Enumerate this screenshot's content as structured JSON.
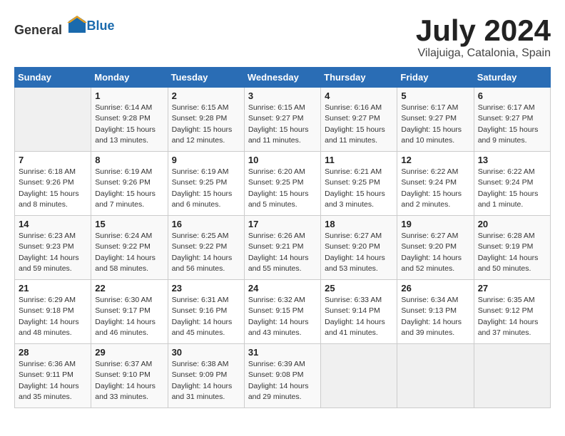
{
  "header": {
    "logo_general": "General",
    "logo_blue": "Blue",
    "title": "July 2024",
    "subtitle": "Vilajuiga, Catalonia, Spain"
  },
  "days_of_week": [
    "Sunday",
    "Monday",
    "Tuesday",
    "Wednesday",
    "Thursday",
    "Friday",
    "Saturday"
  ],
  "weeks": [
    [
      {
        "day": "",
        "info": ""
      },
      {
        "day": "1",
        "info": "Sunrise: 6:14 AM\nSunset: 9:28 PM\nDaylight: 15 hours\nand 13 minutes."
      },
      {
        "day": "2",
        "info": "Sunrise: 6:15 AM\nSunset: 9:28 PM\nDaylight: 15 hours\nand 12 minutes."
      },
      {
        "day": "3",
        "info": "Sunrise: 6:15 AM\nSunset: 9:27 PM\nDaylight: 15 hours\nand 11 minutes."
      },
      {
        "day": "4",
        "info": "Sunrise: 6:16 AM\nSunset: 9:27 PM\nDaylight: 15 hours\nand 11 minutes."
      },
      {
        "day": "5",
        "info": "Sunrise: 6:17 AM\nSunset: 9:27 PM\nDaylight: 15 hours\nand 10 minutes."
      },
      {
        "day": "6",
        "info": "Sunrise: 6:17 AM\nSunset: 9:27 PM\nDaylight: 15 hours\nand 9 minutes."
      }
    ],
    [
      {
        "day": "7",
        "info": "Sunrise: 6:18 AM\nSunset: 9:26 PM\nDaylight: 15 hours\nand 8 minutes."
      },
      {
        "day": "8",
        "info": "Sunrise: 6:19 AM\nSunset: 9:26 PM\nDaylight: 15 hours\nand 7 minutes."
      },
      {
        "day": "9",
        "info": "Sunrise: 6:19 AM\nSunset: 9:25 PM\nDaylight: 15 hours\nand 6 minutes."
      },
      {
        "day": "10",
        "info": "Sunrise: 6:20 AM\nSunset: 9:25 PM\nDaylight: 15 hours\nand 5 minutes."
      },
      {
        "day": "11",
        "info": "Sunrise: 6:21 AM\nSunset: 9:25 PM\nDaylight: 15 hours\nand 3 minutes."
      },
      {
        "day": "12",
        "info": "Sunrise: 6:22 AM\nSunset: 9:24 PM\nDaylight: 15 hours\nand 2 minutes."
      },
      {
        "day": "13",
        "info": "Sunrise: 6:22 AM\nSunset: 9:24 PM\nDaylight: 15 hours\nand 1 minute."
      }
    ],
    [
      {
        "day": "14",
        "info": "Sunrise: 6:23 AM\nSunset: 9:23 PM\nDaylight: 14 hours\nand 59 minutes."
      },
      {
        "day": "15",
        "info": "Sunrise: 6:24 AM\nSunset: 9:22 PM\nDaylight: 14 hours\nand 58 minutes."
      },
      {
        "day": "16",
        "info": "Sunrise: 6:25 AM\nSunset: 9:22 PM\nDaylight: 14 hours\nand 56 minutes."
      },
      {
        "day": "17",
        "info": "Sunrise: 6:26 AM\nSunset: 9:21 PM\nDaylight: 14 hours\nand 55 minutes."
      },
      {
        "day": "18",
        "info": "Sunrise: 6:27 AM\nSunset: 9:20 PM\nDaylight: 14 hours\nand 53 minutes."
      },
      {
        "day": "19",
        "info": "Sunrise: 6:27 AM\nSunset: 9:20 PM\nDaylight: 14 hours\nand 52 minutes."
      },
      {
        "day": "20",
        "info": "Sunrise: 6:28 AM\nSunset: 9:19 PM\nDaylight: 14 hours\nand 50 minutes."
      }
    ],
    [
      {
        "day": "21",
        "info": "Sunrise: 6:29 AM\nSunset: 9:18 PM\nDaylight: 14 hours\nand 48 minutes."
      },
      {
        "day": "22",
        "info": "Sunrise: 6:30 AM\nSunset: 9:17 PM\nDaylight: 14 hours\nand 46 minutes."
      },
      {
        "day": "23",
        "info": "Sunrise: 6:31 AM\nSunset: 9:16 PM\nDaylight: 14 hours\nand 45 minutes."
      },
      {
        "day": "24",
        "info": "Sunrise: 6:32 AM\nSunset: 9:15 PM\nDaylight: 14 hours\nand 43 minutes."
      },
      {
        "day": "25",
        "info": "Sunrise: 6:33 AM\nSunset: 9:14 PM\nDaylight: 14 hours\nand 41 minutes."
      },
      {
        "day": "26",
        "info": "Sunrise: 6:34 AM\nSunset: 9:13 PM\nDaylight: 14 hours\nand 39 minutes."
      },
      {
        "day": "27",
        "info": "Sunrise: 6:35 AM\nSunset: 9:12 PM\nDaylight: 14 hours\nand 37 minutes."
      }
    ],
    [
      {
        "day": "28",
        "info": "Sunrise: 6:36 AM\nSunset: 9:11 PM\nDaylight: 14 hours\nand 35 minutes."
      },
      {
        "day": "29",
        "info": "Sunrise: 6:37 AM\nSunset: 9:10 PM\nDaylight: 14 hours\nand 33 minutes."
      },
      {
        "day": "30",
        "info": "Sunrise: 6:38 AM\nSunset: 9:09 PM\nDaylight: 14 hours\nand 31 minutes."
      },
      {
        "day": "31",
        "info": "Sunrise: 6:39 AM\nSunset: 9:08 PM\nDaylight: 14 hours\nand 29 minutes."
      },
      {
        "day": "",
        "info": ""
      },
      {
        "day": "",
        "info": ""
      },
      {
        "day": "",
        "info": ""
      }
    ]
  ]
}
